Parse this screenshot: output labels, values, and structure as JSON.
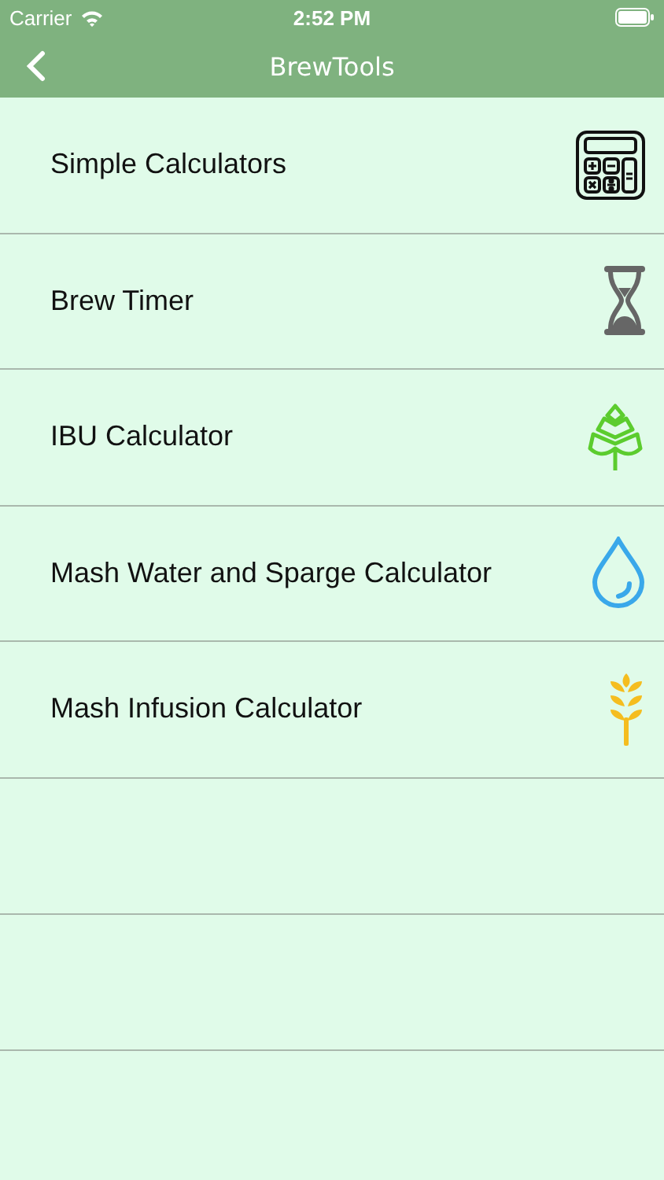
{
  "status_bar": {
    "carrier": "Carrier",
    "time": "2:52 PM"
  },
  "nav": {
    "title": "BrewTools"
  },
  "items": [
    {
      "label": "Simple Calculators",
      "kind": "calculator"
    },
    {
      "label": "Brew Timer",
      "kind": "hourglass"
    },
    {
      "label": "IBU Calculator",
      "kind": "hop"
    },
    {
      "label": "Mash Water and Sparge Calculator",
      "kind": "drop"
    },
    {
      "label": "Mash Infusion Calculator",
      "kind": "wheat"
    }
  ]
}
